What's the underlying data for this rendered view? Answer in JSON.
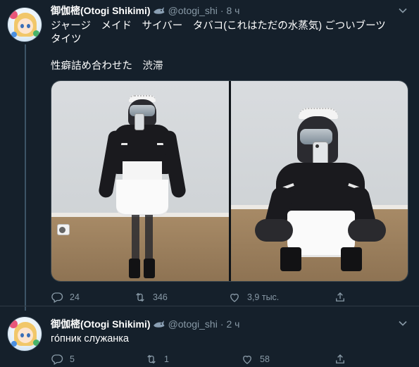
{
  "tweets": [
    {
      "author_name": "御伽樒(Otogi Shikimi)",
      "handle": "@otogi_shi",
      "separator": "·",
      "time": "8 ч",
      "text_line1": "ジャージ　メイド　サイバー　タバコ(これはただの水蒸気) ごついブーツ",
      "text_line2": "タイツ",
      "text_line3": "性癖詰め合わせた　渋滞",
      "actions": {
        "replies": "24",
        "retweets": "346",
        "likes": "3,9 тыс."
      }
    },
    {
      "author_name": "御伽樒(Otogi Shikimi)",
      "handle": "@otogi_shi",
      "separator": "·",
      "time": "2 ч",
      "text_line1": "го́пник служанка",
      "actions": {
        "replies": "5",
        "retweets": "1",
        "likes": "58"
      }
    }
  ],
  "icons": {
    "badge": "shark-icon",
    "more": "chevron-down-icon",
    "reply": "reply-icon",
    "retweet": "retweet-icon",
    "like": "heart-icon",
    "share": "share-icon"
  },
  "colors": {
    "background": "#15202b",
    "text": "#ffffff",
    "muted": "#8899a6",
    "border": "#38444d",
    "thread_line": "#3d5466"
  }
}
